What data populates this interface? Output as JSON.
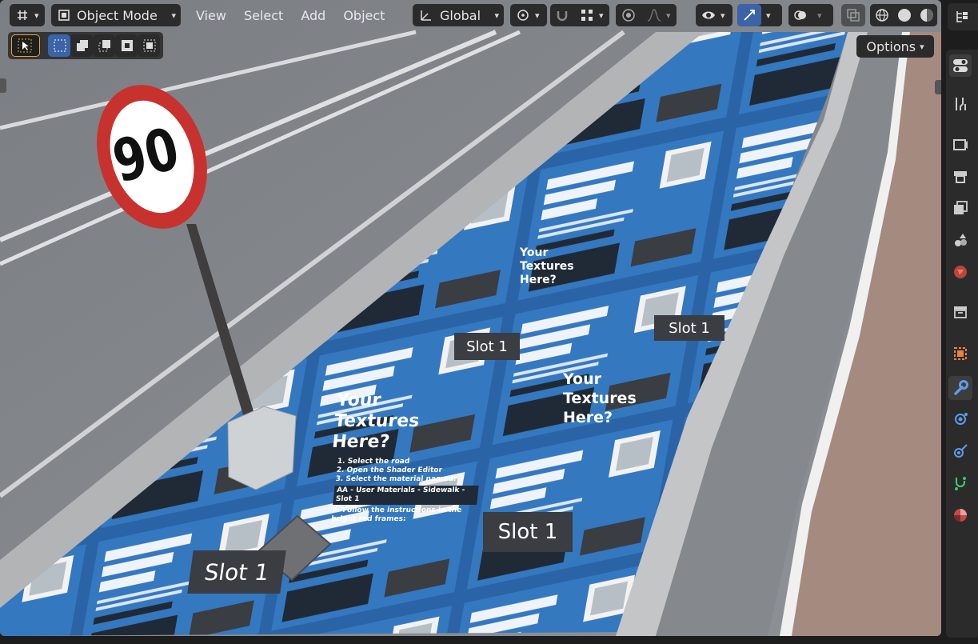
{
  "header": {
    "mode_label": "Object Mode",
    "menus": [
      "View",
      "Select",
      "Add",
      "Object"
    ],
    "orientation_label": "Global"
  },
  "options_label": "Options",
  "scene": {
    "sign_text": "90",
    "tile_heading": "Your Textures Here?",
    "tile_heading_line1": "Your",
    "tile_heading_line2": "Textures",
    "tile_heading_line3": "Here?",
    "tile_step1": "1. Select the road",
    "tile_step2": "2. Open the Shader Editor",
    "tile_step3": "3. Select the material named:",
    "tile_material": "AA - User Materials - Sidewalk - Slot 1",
    "tile_step4": "4. Follow the instructions in the bright red frames:",
    "slot_label": "Slot 1"
  },
  "colors": {
    "accent": "#3b64a8",
    "tile_blue": "#2e6db4",
    "sign_red": "#c8322e"
  },
  "sidebar_icons": [
    "outliner-icon",
    "toggle-icon",
    "tool-icon",
    "render-icon",
    "output-icon",
    "view-layer-icon",
    "scene-icon",
    "world-icon",
    "collection-icon",
    "object-icon",
    "modifier-icon",
    "particles-icon",
    "physics-icon",
    "constraints-icon",
    "data-icon"
  ]
}
